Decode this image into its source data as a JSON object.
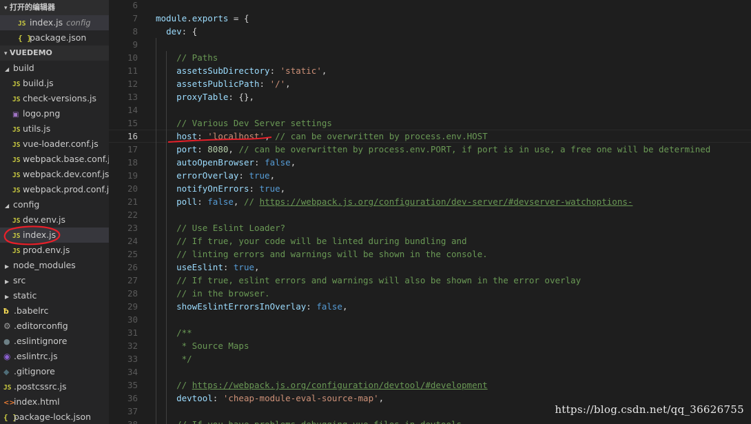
{
  "sidebar": {
    "open_editors_title": "打开的编辑器",
    "open_editors": [
      {
        "icon": "JS",
        "label": "index.js",
        "hint": "config"
      },
      {
        "icon": "{ }",
        "label": "package.json",
        "hint": ""
      }
    ],
    "project_title": "VUEDEMO",
    "tree": [
      {
        "type": "folder",
        "label": "build",
        "open": true,
        "indent": 1
      },
      {
        "type": "js",
        "label": "build.js",
        "indent": 2
      },
      {
        "type": "js",
        "label": "check-versions.js",
        "indent": 2
      },
      {
        "type": "png",
        "label": "logo.png",
        "indent": 2
      },
      {
        "type": "js",
        "label": "utils.js",
        "indent": 2
      },
      {
        "type": "js",
        "label": "vue-loader.conf.js",
        "indent": 2
      },
      {
        "type": "js",
        "label": "webpack.base.conf.js",
        "indent": 2
      },
      {
        "type": "js",
        "label": "webpack.dev.conf.js",
        "indent": 2
      },
      {
        "type": "js",
        "label": "webpack.prod.conf.js",
        "indent": 2
      },
      {
        "type": "folder",
        "label": "config",
        "open": true,
        "indent": 1
      },
      {
        "type": "js",
        "label": "dev.env.js",
        "indent": 2
      },
      {
        "type": "js",
        "label": "index.js",
        "indent": 2,
        "selected": true
      },
      {
        "type": "js",
        "label": "prod.env.js",
        "indent": 2
      },
      {
        "type": "folder",
        "label": "node_modules",
        "open": false,
        "indent": 1
      },
      {
        "type": "folder",
        "label": "src",
        "open": false,
        "indent": 1
      },
      {
        "type": "folder",
        "label": "static",
        "open": false,
        "indent": 1
      },
      {
        "type": "babel",
        "label": ".babelrc",
        "indent": 1
      },
      {
        "type": "gear",
        "label": ".editorconfig",
        "indent": 1
      },
      {
        "type": "dot",
        "label": ".eslintignore",
        "indent": 1
      },
      {
        "type": "eslintrc",
        "label": ".eslintrc.js",
        "indent": 1
      },
      {
        "type": "git",
        "label": ".gitignore",
        "indent": 1
      },
      {
        "type": "js",
        "label": ".postcssrc.js",
        "indent": 1
      },
      {
        "type": "html",
        "label": "index.html",
        "indent": 1
      },
      {
        "type": "json",
        "label": "package-lock.json",
        "indent": 1
      }
    ]
  },
  "editor": {
    "active_line": 16,
    "lines": [
      {
        "n": 6,
        "indent": 0,
        "tokens": []
      },
      {
        "n": 7,
        "indent": 0,
        "tokens": [
          [
            "k",
            "module"
          ],
          [
            "p",
            "."
          ],
          [
            "k",
            "exports"
          ],
          [
            "p",
            " = {"
          ]
        ]
      },
      {
        "n": 8,
        "indent": 1,
        "tokens": [
          [
            "k",
            "dev"
          ],
          [
            "p",
            ": {"
          ]
        ]
      },
      {
        "n": 9,
        "indent": 2,
        "tokens": []
      },
      {
        "n": 10,
        "indent": 2,
        "tokens": [
          [
            "c",
            "// Paths"
          ]
        ]
      },
      {
        "n": 11,
        "indent": 2,
        "tokens": [
          [
            "k",
            "assetsSubDirectory"
          ],
          [
            "p",
            ": "
          ],
          [
            "s",
            "'static'"
          ],
          [
            "p",
            ","
          ]
        ]
      },
      {
        "n": 12,
        "indent": 2,
        "tokens": [
          [
            "k",
            "assetsPublicPath"
          ],
          [
            "p",
            ": "
          ],
          [
            "s",
            "'/'"
          ],
          [
            "p",
            ","
          ]
        ]
      },
      {
        "n": 13,
        "indent": 2,
        "tokens": [
          [
            "k",
            "proxyTable"
          ],
          [
            "p",
            ": {},"
          ]
        ]
      },
      {
        "n": 14,
        "indent": 2,
        "tokens": []
      },
      {
        "n": 15,
        "indent": 2,
        "tokens": [
          [
            "c",
            "// Various Dev Server settings"
          ]
        ]
      },
      {
        "n": 16,
        "indent": 2,
        "tokens": [
          [
            "k",
            "host"
          ],
          [
            "p",
            ": "
          ],
          [
            "s",
            "'localhost'"
          ],
          [
            "p",
            ", "
          ],
          [
            "c",
            "// can be overwritten by process.env.HOST"
          ]
        ]
      },
      {
        "n": 17,
        "indent": 2,
        "tokens": [
          [
            "k",
            "port"
          ],
          [
            "p",
            ": "
          ],
          [
            "n",
            "8080"
          ],
          [
            "p",
            ", "
          ],
          [
            "c",
            "// can be overwritten by process.env.PORT, if port is in use, a free one will be determined"
          ]
        ]
      },
      {
        "n": 18,
        "indent": 2,
        "tokens": [
          [
            "k",
            "autoOpenBrowser"
          ],
          [
            "p",
            ": "
          ],
          [
            "b",
            "false"
          ],
          [
            "p",
            ","
          ]
        ]
      },
      {
        "n": 19,
        "indent": 2,
        "tokens": [
          [
            "k",
            "errorOverlay"
          ],
          [
            "p",
            ": "
          ],
          [
            "b",
            "true"
          ],
          [
            "p",
            ","
          ]
        ]
      },
      {
        "n": 20,
        "indent": 2,
        "tokens": [
          [
            "k",
            "notifyOnErrors"
          ],
          [
            "p",
            ": "
          ],
          [
            "b",
            "true"
          ],
          [
            "p",
            ","
          ]
        ]
      },
      {
        "n": 21,
        "indent": 2,
        "tokens": [
          [
            "k",
            "poll"
          ],
          [
            "p",
            ": "
          ],
          [
            "b",
            "false"
          ],
          [
            "p",
            ", "
          ],
          [
            "c",
            "// "
          ],
          [
            "u",
            "https://webpack.js.org/configuration/dev-server/#devserver-watchoptions-"
          ]
        ]
      },
      {
        "n": 22,
        "indent": 2,
        "tokens": []
      },
      {
        "n": 23,
        "indent": 2,
        "tokens": [
          [
            "c",
            "// Use Eslint Loader?"
          ]
        ]
      },
      {
        "n": 24,
        "indent": 2,
        "tokens": [
          [
            "c",
            "// If true, your code will be linted during bundling and"
          ]
        ]
      },
      {
        "n": 25,
        "indent": 2,
        "tokens": [
          [
            "c",
            "// linting errors and warnings will be shown in the console."
          ]
        ]
      },
      {
        "n": 26,
        "indent": 2,
        "tokens": [
          [
            "k",
            "useEslint"
          ],
          [
            "p",
            ": "
          ],
          [
            "b",
            "true"
          ],
          [
            "p",
            ","
          ]
        ]
      },
      {
        "n": 27,
        "indent": 2,
        "tokens": [
          [
            "c",
            "// If true, eslint errors and warnings will also be shown in the error overlay"
          ]
        ]
      },
      {
        "n": 28,
        "indent": 2,
        "tokens": [
          [
            "c",
            "// in the browser."
          ]
        ]
      },
      {
        "n": 29,
        "indent": 2,
        "tokens": [
          [
            "k",
            "showEslintErrorsInOverlay"
          ],
          [
            "p",
            ": "
          ],
          [
            "b",
            "false"
          ],
          [
            "p",
            ","
          ]
        ]
      },
      {
        "n": 30,
        "indent": 2,
        "tokens": []
      },
      {
        "n": 31,
        "indent": 2,
        "tokens": [
          [
            "c",
            "/**"
          ]
        ]
      },
      {
        "n": 32,
        "indent": 2,
        "tokens": [
          [
            "c",
            " * Source Maps"
          ]
        ]
      },
      {
        "n": 33,
        "indent": 2,
        "tokens": [
          [
            "c",
            " */"
          ]
        ]
      },
      {
        "n": 34,
        "indent": 2,
        "tokens": []
      },
      {
        "n": 35,
        "indent": 2,
        "tokens": [
          [
            "c",
            "// "
          ],
          [
            "u",
            "https://webpack.js.org/configuration/devtool/#development"
          ]
        ]
      },
      {
        "n": 36,
        "indent": 2,
        "tokens": [
          [
            "k",
            "devtool"
          ],
          [
            "p",
            ": "
          ],
          [
            "s",
            "'cheap-module-eval-source-map'"
          ],
          [
            "p",
            ","
          ]
        ]
      },
      {
        "n": 37,
        "indent": 2,
        "tokens": []
      },
      {
        "n": 38,
        "indent": 2,
        "tokens": [
          [
            "c",
            "// If you have problems debugging vue-files in devtools,"
          ]
        ]
      }
    ]
  },
  "watermark": "https://blog.csdn.net/qq_36626755",
  "colors": {
    "annotation": "#e8202a"
  }
}
